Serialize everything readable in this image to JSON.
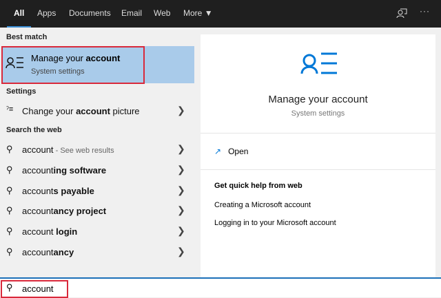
{
  "tabs": [
    "All",
    "Apps",
    "Documents",
    "Email",
    "Web",
    "More"
  ],
  "sections": {
    "best_match": "Best match",
    "settings": "Settings",
    "web": "Search the web"
  },
  "best": {
    "title_pre": "Manage your ",
    "title_bold": "account",
    "subtitle": "System settings"
  },
  "settings_item": {
    "pre": "Change your ",
    "bold": "account",
    "post": " picture"
  },
  "web_results": [
    {
      "pre": "account",
      "bold": "",
      "suffix": " - See web results"
    },
    {
      "pre": "account",
      "bold": "ing software",
      "suffix": ""
    },
    {
      "pre": "account",
      "bold": "s payable",
      "suffix": ""
    },
    {
      "pre": "account",
      "bold": "ancy project",
      "suffix": ""
    },
    {
      "pre": "account",
      "bold": " login",
      "suffix": ""
    },
    {
      "pre": "account",
      "bold": "ancy",
      "suffix": ""
    }
  ],
  "detail": {
    "title": "Manage your account",
    "subtitle": "System settings",
    "open": "Open",
    "help_header": "Get quick help from web",
    "links": [
      "Creating a Microsoft account",
      "Logging in to your Microsoft account"
    ]
  },
  "search": {
    "value": "account"
  },
  "colors": {
    "accent": "#0078d7",
    "highlight": "#a9cbea",
    "outline": "#d9283a"
  }
}
